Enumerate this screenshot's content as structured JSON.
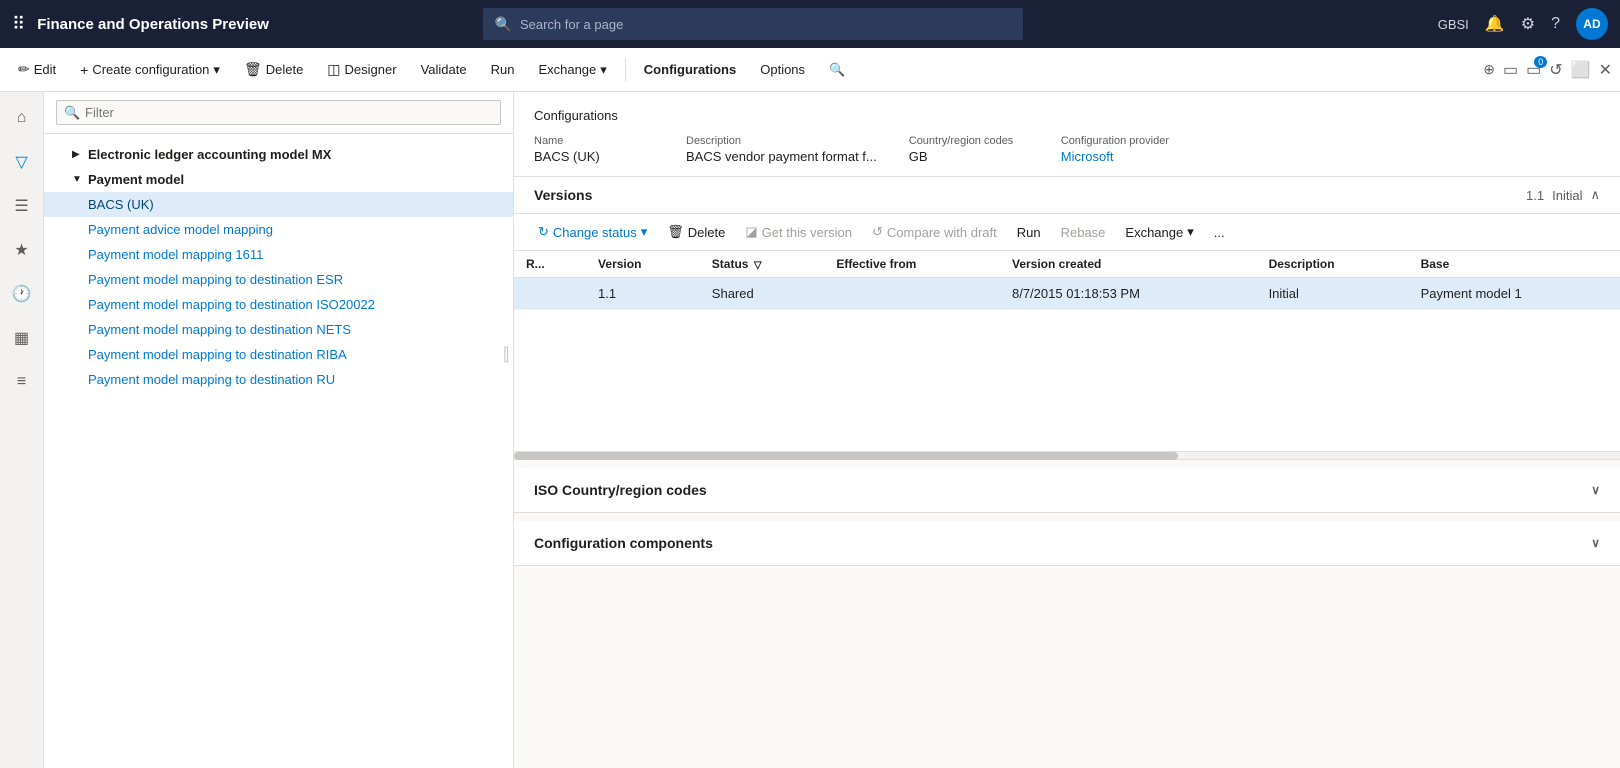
{
  "app": {
    "title": "Finance and Operations Preview",
    "search_placeholder": "Search for a page"
  },
  "top_nav": {
    "user_initials": "AD",
    "user_label": "GBSI"
  },
  "toolbar": {
    "edit_label": "Edit",
    "create_config_label": "Create configuration",
    "delete_label": "Delete",
    "designer_label": "Designer",
    "validate_label": "Validate",
    "run_label": "Run",
    "exchange_label": "Exchange",
    "configurations_label": "Configurations",
    "options_label": "Options"
  },
  "sidebar_icons": {
    "home": "⌂",
    "star": "★",
    "clock": "⏱",
    "grid": "▦",
    "list": "≡"
  },
  "tree_filter": {
    "placeholder": "Filter"
  },
  "tree": {
    "items": [
      {
        "label": "Electronic ledger accounting model MX",
        "indent": 1,
        "expandable": true,
        "expanded": false,
        "color": "black"
      },
      {
        "label": "Payment model",
        "indent": 1,
        "expandable": true,
        "expanded": true,
        "color": "black"
      },
      {
        "label": "BACS (UK)",
        "indent": 2,
        "selected": true,
        "color": "blue"
      },
      {
        "label": "Payment advice model mapping",
        "indent": 2,
        "color": "blue"
      },
      {
        "label": "Payment model mapping 1611",
        "indent": 2,
        "color": "blue"
      },
      {
        "label": "Payment model mapping to destination ESR",
        "indent": 2,
        "color": "blue"
      },
      {
        "label": "Payment model mapping to destination ISO20022",
        "indent": 2,
        "color": "blue"
      },
      {
        "label": "Payment model mapping to destination NETS",
        "indent": 2,
        "color": "blue"
      },
      {
        "label": "Payment model mapping to destination RIBA",
        "indent": 2,
        "color": "blue"
      },
      {
        "label": "Payment model mapping to destination RU",
        "indent": 2,
        "color": "blue"
      }
    ]
  },
  "config_detail": {
    "section_title": "Configurations",
    "fields": [
      {
        "label": "Name",
        "value": "BACS (UK)",
        "type": "text"
      },
      {
        "label": "Description",
        "value": "BACS vendor payment format f...",
        "type": "text"
      },
      {
        "label": "Country/region codes",
        "value": "GB",
        "type": "text"
      },
      {
        "label": "Configuration provider",
        "value": "Microsoft",
        "type": "link"
      }
    ]
  },
  "versions": {
    "title": "Versions",
    "version_badge": "1.1",
    "status_badge": "Initial",
    "toolbar": {
      "change_status": "Change status",
      "delete": "Delete",
      "get_this_version": "Get this version",
      "compare_with_draft": "Compare with draft",
      "run": "Run",
      "rebase": "Rebase",
      "exchange": "Exchange",
      "more": "..."
    },
    "table": {
      "columns": [
        "R...",
        "Version",
        "Status",
        "Effective from",
        "Version created",
        "Description",
        "Base"
      ],
      "rows": [
        {
          "col0": "",
          "version": "1.1",
          "status": "Shared",
          "effective_from": "",
          "version_created": "8/7/2015 01:18:53 PM",
          "description": "Initial",
          "base": "Payment model  1"
        }
      ]
    }
  },
  "iso_section": {
    "title": "ISO Country/region codes"
  },
  "config_components_section": {
    "title": "Configuration components"
  }
}
